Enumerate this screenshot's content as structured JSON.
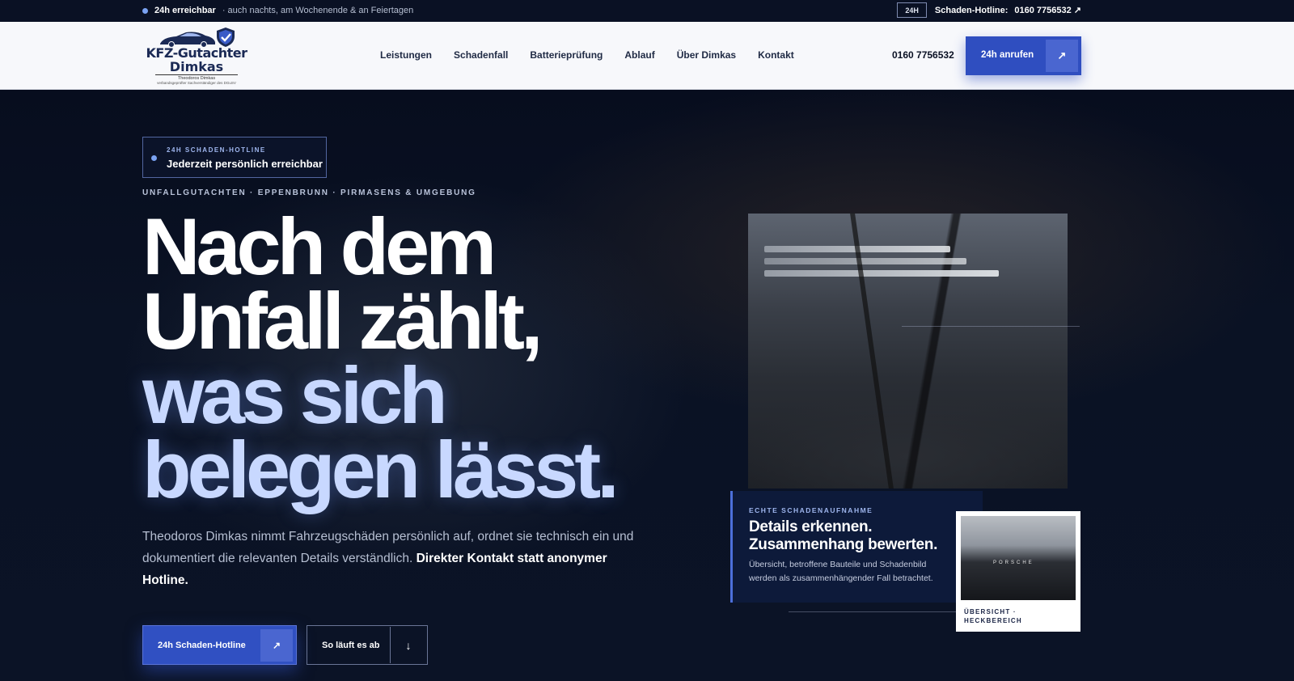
{
  "topbar": {
    "availability": "24h erreichbar",
    "availability_note": "· auch nachts, am Wochenende & an Feiertagen",
    "badge": "24H",
    "hotline_label": "Schaden-Hotline:",
    "hotline_number": "0160 7756532 ↗"
  },
  "nav": {
    "logo": {
      "title": "KFZ-Gutachter",
      "name": "Dimkas",
      "subtitle": "Theodoros Dimkas",
      "subtitle2": "verbandsgeprüfter Sachverständiger des DGuSV"
    },
    "items": [
      {
        "label": "Leistungen"
      },
      {
        "label": "Schadenfall"
      },
      {
        "label": "Batterieprüfung"
      },
      {
        "label": "Ablauf"
      },
      {
        "label": "Über Dimkas"
      },
      {
        "label": "Kontakt"
      }
    ],
    "phone": "0160 7756532",
    "call_button": "24h anrufen",
    "call_icon": "↗"
  },
  "hero": {
    "tag_kicker": "24H SCHADEN-HOTLINE",
    "tag_text": "Jederzeit persönlich erreichbar",
    "kicker": "UNFALLGUTACHTEN · EPPENBRUNN · PIRMASENS & UMGEBUNG",
    "headline": {
      "line1": "Nach dem",
      "line2": "Unfall zählt,",
      "line3": "was sich",
      "line4": "belegen lässt."
    },
    "lead_text": "Theodoros Dimkas nimmt Fahrzeugschäden persönlich auf, ordnet sie technisch ein und dokumentiert die relevanten Details verständlich.",
    "lead_strong": "Direkter Kontakt statt anonymer Hotline.",
    "primary_button": "24h Schaden-Hotline",
    "primary_icon": "↗",
    "secondary_button": "So läuft es ab",
    "secondary_icon": "↓"
  },
  "collage": {
    "caption_kicker": "ECHTE SCHADENAUFNAHME",
    "caption_title_1": "Details erkennen.",
    "caption_title_2": "Zusammenhang bewerten.",
    "caption_text": "Übersicht, betroffene Bauteile und Schadenbild werden als zusammenhängender Fall betrachtet.",
    "thumb_brand": "PORSCHE",
    "thumb_caption_1": "ÜBERSICHT ·",
    "thumb_caption_2": "HECKBEREICH"
  },
  "colors": {
    "accent": "#3050c2",
    "accent_light": "#c8d8ff",
    "navy": "#0a1124"
  }
}
